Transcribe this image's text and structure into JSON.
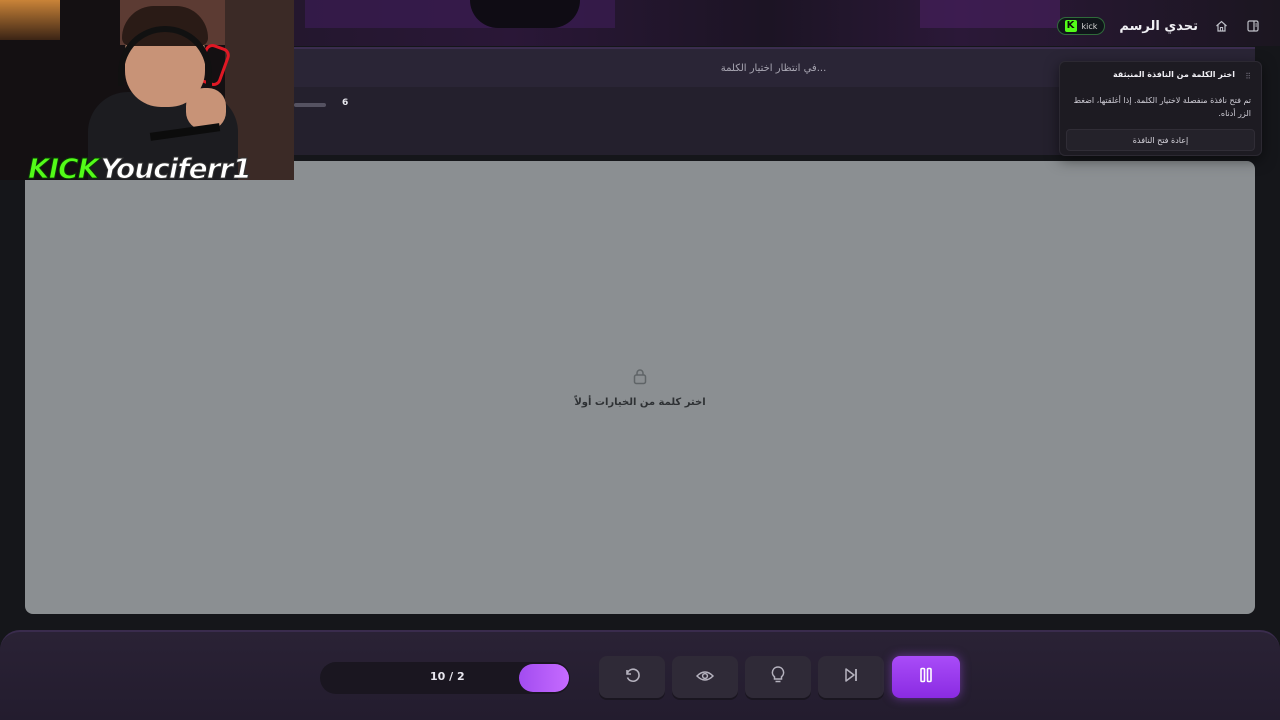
{
  "header": {
    "title": "تحدي الرسم",
    "kick_badge": "kick",
    "kick_logo": "K"
  },
  "status": {
    "waiting_text": "في انتظار اختيار الكلمة...",
    "count": "6"
  },
  "canvas": {
    "locked_message": "اختر كلمة من الخيارات أولاً",
    "lock_icon": "lock-icon",
    "background_color": "#8b8f92"
  },
  "popup": {
    "title": "اختر الكلمة من النافذة المنبثقة",
    "body": "تم فتح نافذة منفصلة لاختيار الكلمة. إذا أغلقتها، اضغط الزر أدناه.",
    "button_label": "إعادة فتح النافذة"
  },
  "webcam": {
    "brand": "KICK",
    "username": "Youciferr1"
  },
  "controls": {
    "round_label": "10 / 2",
    "round_current": 2,
    "round_total": 10,
    "buttons": [
      "restart-icon",
      "eye-icon",
      "lightbulb-icon",
      "skip-icon",
      "pause-icon"
    ],
    "accent": "#a94cf8"
  }
}
